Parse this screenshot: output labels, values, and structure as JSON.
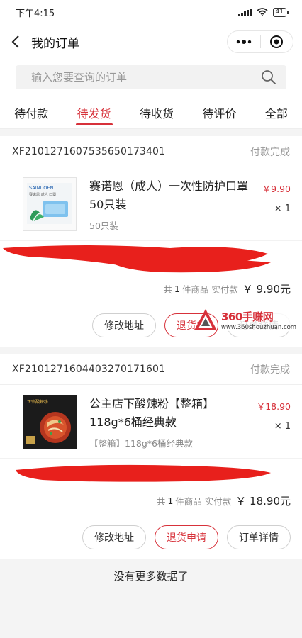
{
  "status_bar": {
    "time": "下午4:15",
    "battery": "41"
  },
  "nav": {
    "title": "我的订单"
  },
  "search": {
    "placeholder": "输入您要查询的订单"
  },
  "tabs": [
    {
      "label": "待付款",
      "active": false
    },
    {
      "label": "待发货",
      "active": true
    },
    {
      "label": "待收货",
      "active": false
    },
    {
      "label": "待评价",
      "active": false
    },
    {
      "label": "全部",
      "active": false
    }
  ],
  "orders": [
    {
      "order_no": "XF210127160753565017340​1",
      "status": "付款完成",
      "product": {
        "name": "赛诺恩（成人）一次性防护口罩 50只装",
        "spec": "50只装",
        "price": "￥9.90",
        "qty": "× 1",
        "thumb_brand": "SAINUOEN",
        "thumb_caption": "赛诺恩 成人 口罩"
      },
      "summary": {
        "prefix": "共",
        "count": "1",
        "suffix": "件商品 实付款",
        "total": "￥ 9.90元"
      },
      "actions": {
        "modify": "修改地址",
        "refund": "退货申",
        "detail": "订单详情"
      }
    },
    {
      "order_no": "XF2101271604403270171601",
      "status": "付款完成",
      "product": {
        "name": "公主店下酸辣粉【整箱】118g*6桶经典款",
        "spec": "【整箱】118g*6桶经典款",
        "price": "￥18.90",
        "qty": "× 1",
        "thumb_caption": "正宗酸辣粉"
      },
      "summary": {
        "prefix": "共",
        "count": "1",
        "suffix": "件商品 实付款",
        "total": "￥ 18.90元"
      },
      "actions": {
        "modify": "修改地址",
        "refund": "退货申请",
        "detail": "订单详情"
      }
    }
  ],
  "watermark": {
    "title": "360手赚网",
    "url": "www.360shouzhuan.com"
  },
  "footer": {
    "text": "没有更多数据了"
  },
  "colors": {
    "accent": "#d7313a",
    "redaction": "#e8201c"
  }
}
